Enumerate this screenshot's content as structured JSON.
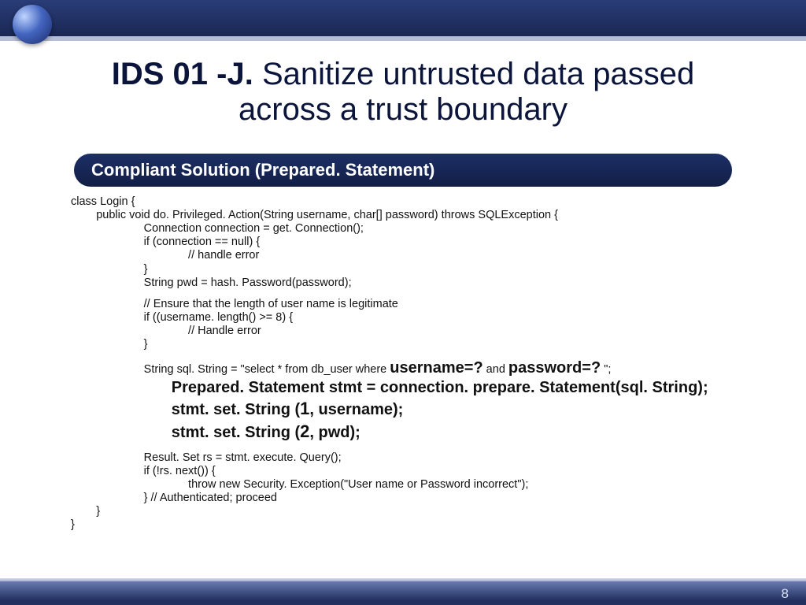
{
  "title": {
    "prefix": "IDS 01 -J.",
    "rest_line1": " Sanitize untrusted data passed",
    "line2": "across a trust boundary"
  },
  "pill_label": "Compliant Solution (Prepared. Statement)",
  "code": {
    "l01": "class Login {",
    "l02": "        public void do. Privileged. Action(String username, char[] password) throws SQLException {",
    "l03": "                       Connection connection = get. Connection();",
    "l04": "                       if (connection == null) {",
    "l05": "                                     // handle error",
    "l06": "                       }",
    "l07": "                       String pwd = hash. Password(password);",
    "l08": "                       // Ensure that the length of user name is legitimate",
    "l09": "                       if ((username. length() >= 8) {",
    "l10": "                                     // Handle error",
    "l11": "                       }",
    "sql_pre": "                       String sql. String = \"select * from db_user where ",
    "sql_u": "username=?",
    "sql_mid": " and ",
    "sql_p": "password=?",
    "sql_tail": " \";",
    "p1": "                       Prepared. Statement stmt = connection. prepare. Statement(sql. String);",
    "p2a": "                       stmt. set. String (",
    "p2n": "1",
    "p2b": ", username);",
    "p3a": "                       stmt. set. String (",
    "p3n": "2",
    "p3b": ", pwd);",
    "l12": "                       Result. Set rs = stmt. execute. Query();",
    "l13": "                       if (!rs. next()) {",
    "l14": "                                     throw new Security. Exception(\"User name or Password incorrect\");",
    "l15": "                       } // Authenticated; proceed",
    "l16": "        }",
    "l17": "}"
  },
  "page_number": "8"
}
